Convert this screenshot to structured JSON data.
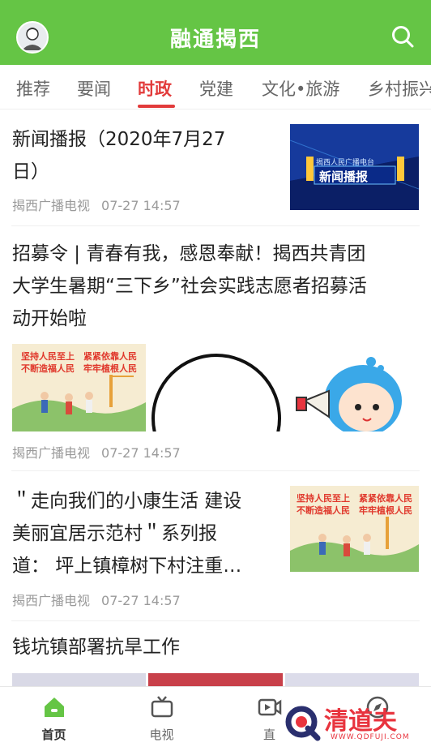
{
  "header": {
    "title": "融通揭西"
  },
  "tabs": [
    {
      "label": "推荐"
    },
    {
      "label": "要闻"
    },
    {
      "label": "时政"
    },
    {
      "label": "党建"
    },
    {
      "label": "文化•旅游"
    },
    {
      "label": "乡村振兴"
    }
  ],
  "active_tab": "时政",
  "news": [
    {
      "title_line1": "新闻播报（2020年7月27",
      "title_line2": "日）",
      "source": "揭西广播电视",
      "time": "07-27 14:57",
      "thumb_caption_small": "揭西人民广播电台",
      "thumb_caption": "新闻播报"
    },
    {
      "title_line1": "招募令 | 青春有我，感恩奉献！揭西共青团",
      "title_line2": "大学生暑期“三下乡”社会实践志愿者招募活",
      "title_line3": "动开始啦",
      "source": "揭西广播电视",
      "time": "07-27 14:57",
      "poster_slogan_1": "坚持人民至上　紧紧依靠人民",
      "poster_slogan_2": "不断造福人民　牢牢植根人民"
    },
    {
      "title_line1": "＂走向我们的小康生活 建设",
      "title_line2": "美丽宜居示范村＂系列报",
      "title_line3": "道： 坪上镇樟树下村注重…",
      "source": "揭西广播电视",
      "time": "07-27 14:57",
      "poster_slogan_1": "坚持人民至上　紧紧依靠人民",
      "poster_slogan_2": "不断造福人民　牢牢植根人民"
    },
    {
      "title_line1": "钱坑镇部署抗旱工作"
    }
  ],
  "tabbar": [
    {
      "label": "首页",
      "icon": "home-icon"
    },
    {
      "label": "电视",
      "icon": "tv-icon"
    },
    {
      "label": "直",
      "icon": "live-video-icon"
    },
    {
      "label": "",
      "icon": "compass-icon"
    }
  ],
  "watermark": {
    "text": "清道夫",
    "sub": "WWW.QDFUJI.COM"
  },
  "colors": {
    "brand_green": "#65c545",
    "active_red": "#e23b3b"
  }
}
